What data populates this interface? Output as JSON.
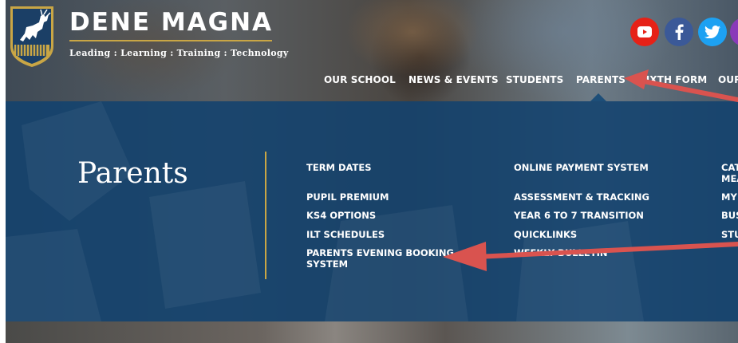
{
  "brand": {
    "name": "DENE MAGNA",
    "tagline": "Leading : Learning : Training : Technology",
    "accent_color": "#c9a645"
  },
  "social": [
    {
      "name": "youtube",
      "icon": "youtube-icon",
      "color": "#e62117"
    },
    {
      "name": "facebook",
      "icon": "facebook-icon",
      "color": "#3b5998"
    },
    {
      "name": "twitter",
      "icon": "twitter-icon",
      "color": "#1da1f2"
    },
    {
      "name": "instagram",
      "icon": "instagram-icon",
      "color": "#8a3ab9"
    }
  ],
  "nav": {
    "items": [
      {
        "label": "OUR SCHOOL"
      },
      {
        "label": "NEWS & EVENTS"
      },
      {
        "label": "STUDENTS"
      },
      {
        "label": "PARENTS",
        "active": true
      },
      {
        "label": "SIXTH FORM"
      },
      {
        "label": "OUR"
      }
    ]
  },
  "mega_menu": {
    "title": "Parents",
    "background_color": "#12426e",
    "columns": [
      {
        "links": [
          {
            "label": "TERM DATES"
          },
          {
            "label": "PUPIL PREMIUM"
          },
          {
            "label": "KS4 OPTIONS"
          },
          {
            "label": "ILT SCHEDULES"
          },
          {
            "label": "PARENTS EVENING BOOKING",
            "label_line2": "SYSTEM"
          }
        ]
      },
      {
        "links": [
          {
            "label": "ONLINE PAYMENT SYSTEM"
          },
          {
            "label": "ASSESSMENT & TRACKING"
          },
          {
            "label": "YEAR 6 TO 7 TRANSITION"
          },
          {
            "label": "QUICKLINKS"
          },
          {
            "label": "WEEKLY BULLETIN"
          }
        ]
      },
      {
        "links": [
          {
            "label": "CAT",
            "label_line2": "MEA"
          },
          {
            "label": "MY"
          },
          {
            "label": "BUS"
          },
          {
            "label": "STU"
          }
        ]
      }
    ]
  },
  "annotations": {
    "arrow_color": "#d9534f"
  }
}
